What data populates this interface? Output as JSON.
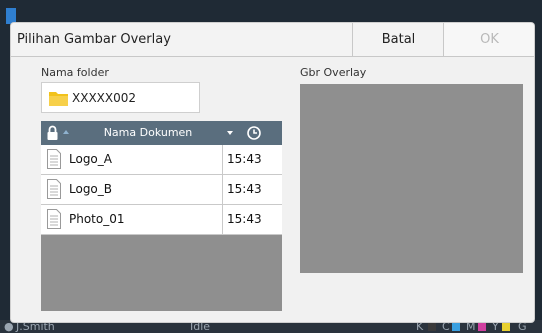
{
  "background": {
    "user_name": "J.Smith",
    "status": "Idle",
    "ink_letters": [
      "K",
      "C",
      "M",
      "Y",
      "G"
    ],
    "ink_colors": [
      "#3a3a3a",
      "#3aa0e0",
      "#d040a0",
      "#e8d030",
      "#9a9a9a"
    ]
  },
  "dialog": {
    "title": "Pilihan Gambar Overlay",
    "cancel_label": "Batal",
    "ok_label": "OK",
    "folder_label": "Nama folder",
    "folder_name": "XXXXX002",
    "preview_label": "Gbr Overlay",
    "list": {
      "column_name": "Nama Dokumen",
      "lock_icon": "lock-icon",
      "clock_icon": "clock-icon",
      "rows": [
        {
          "name": "Logo_A",
          "time": "15:43"
        },
        {
          "name": "Logo_B",
          "time": "15:43"
        },
        {
          "name": "Photo_01",
          "time": "15:43"
        }
      ]
    }
  },
  "colors": {
    "header_bar": "#5a6e7e",
    "folder_yellow": "#f2c21b",
    "preview_gray": "#8f8f8f"
  }
}
